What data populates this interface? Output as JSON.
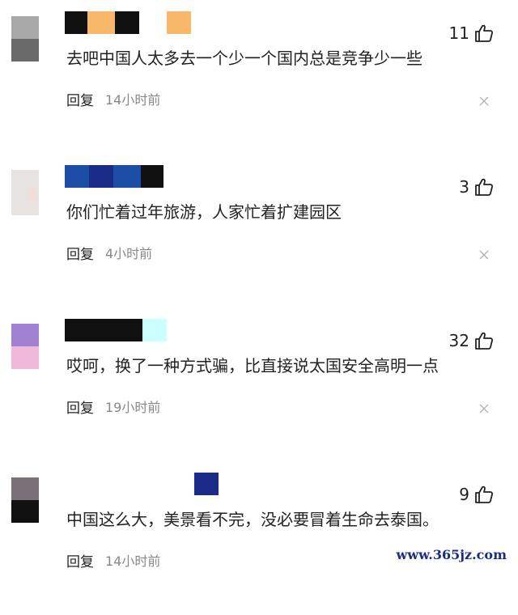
{
  "comments": [
    {
      "likes": "11",
      "text": "去吧中国人太多去一个少一个国内总是竞争少一些",
      "reply_label": "回复",
      "time": "14小时前"
    },
    {
      "likes": "3",
      "text": "你们忙着过年旅游，人家忙着扩建园区",
      "reply_label": "回复",
      "time": "4小时前"
    },
    {
      "likes": "32",
      "text": "哎呵，换了一种方式骗，比直接说太国安全高明一点",
      "reply_label": "回复",
      "time": "19小时前"
    },
    {
      "likes": "9",
      "text": "中国这么大，美景看不完，没必要冒着生命去泰国。",
      "reply_label": "回复",
      "time": "14小时前"
    }
  ],
  "icons": {
    "like": "thumbs-up-icon",
    "dismiss": "close-icon"
  },
  "colors": {
    "text": "#222222",
    "muted": "#888888",
    "redaction_dark": "#111111",
    "redaction_orange": "#f7b86a",
    "redaction_blue": "#1c4ea8",
    "redaction_navy": "#1a2c88",
    "redaction_cyan": "#ccffff",
    "avatar_purple": "#a080d0",
    "avatar_pink": "#f0b8d8"
  },
  "watermark": "www.365jz.com"
}
